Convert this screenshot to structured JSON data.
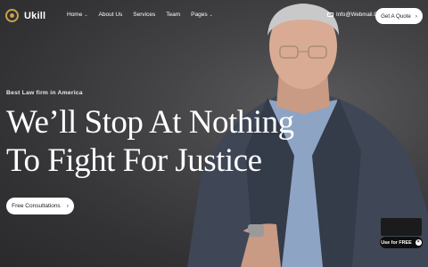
{
  "brand": {
    "name": "Ukill",
    "accent": "#c9a24a"
  },
  "nav": {
    "items": [
      {
        "label": "Home",
        "has_dropdown": true
      },
      {
        "label": "About Us",
        "has_dropdown": false
      },
      {
        "label": "Services",
        "has_dropdown": false
      },
      {
        "label": "Team",
        "has_dropdown": false
      },
      {
        "label": "Pages",
        "has_dropdown": true
      }
    ],
    "dropdown_glyph": "⌄"
  },
  "header": {
    "email": "Info@Webmail.Com",
    "email_icon": "mail-icon",
    "cta_label": "Get A Quote",
    "cta_icon": "arrow-right-icon"
  },
  "hero": {
    "eyebrow": "Best Law firm  in America",
    "headline_line1": "We’ll Stop At Nothing",
    "headline_line2": "To Fight For Justice",
    "button_label": "Free Consultations",
    "button_icon": "arrow-right-icon"
  },
  "badge": {
    "label": "Use for FREE",
    "icon": "close-icon"
  }
}
